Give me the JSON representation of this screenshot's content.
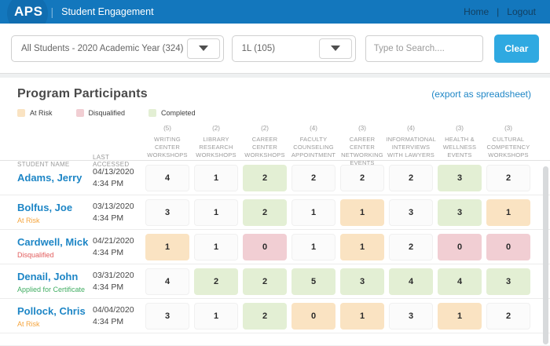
{
  "navbar": {
    "logo": "APS",
    "separator": "|",
    "title": "Student Engagement",
    "home_label": "Home",
    "logout_label": "Logout"
  },
  "filters": {
    "cohort_value": "All Students - 2020 Academic Year  (324)",
    "class_value": "1L (105)",
    "search_placeholder": "Type to Search....",
    "clear_label": "Clear"
  },
  "content": {
    "title": "Program Participants",
    "export_label": "(export as spreadsheet)",
    "legend": [
      {
        "label": "At Risk",
        "color": "#fae3c2"
      },
      {
        "label": "Disqualified",
        "color": "#f1ced3"
      },
      {
        "label": "Completed",
        "color": "#e3efd4"
      }
    ]
  },
  "table": {
    "name_header": "STUDENT NAME",
    "accessed_header": "LAST ACCESSED",
    "columns": [
      {
        "count": "(5)",
        "label": "WRITING CENTER WORKSHOPS"
      },
      {
        "count": "(2)",
        "label": "LIBRARY RESEARCH WORKSHOPS"
      },
      {
        "count": "(2)",
        "label": "CAREER CENTER WORKSHOPS"
      },
      {
        "count": "(4)",
        "label": "FACULTY COUNSELING APPOINTMENT"
      },
      {
        "count": "(3)",
        "label": "CAREER CENTER NETWORKING EVENTS"
      },
      {
        "count": "(4)",
        "label": "INFORMATIONAL INTERVIEWS WITH LAWYERS"
      },
      {
        "count": "(3)",
        "label": "HEALTH & WELLNESS EVENTS"
      },
      {
        "count": "(3)",
        "label": "CULTURAL COMPETENCY WORKSHOPS"
      }
    ],
    "rows": [
      {
        "name": "Adams, Jerry",
        "status": "",
        "status_color": "",
        "date": "04/13/2020",
        "time": "4:34 PM",
        "cells": [
          {
            "value": "4",
            "state": "plain"
          },
          {
            "value": "1",
            "state": "plain"
          },
          {
            "value": "2",
            "state": "green"
          },
          {
            "value": "2",
            "state": "plain"
          },
          {
            "value": "2",
            "state": "plain"
          },
          {
            "value": "2",
            "state": "plain"
          },
          {
            "value": "3",
            "state": "green"
          },
          {
            "value": "2",
            "state": "plain"
          }
        ]
      },
      {
        "name": "Bolfus, Joe",
        "status": "At Risk",
        "status_color": "#f5a43c",
        "date": "03/13/2020",
        "time": "4:34 PM",
        "cells": [
          {
            "value": "3",
            "state": "plain"
          },
          {
            "value": "1",
            "state": "plain"
          },
          {
            "value": "2",
            "state": "green"
          },
          {
            "value": "1",
            "state": "plain"
          },
          {
            "value": "1",
            "state": "orange"
          },
          {
            "value": "3",
            "state": "plain"
          },
          {
            "value": "3",
            "state": "green"
          },
          {
            "value": "1",
            "state": "orange"
          }
        ]
      },
      {
        "name": "Cardwell, Mick",
        "status": "Disqualified",
        "status_color": "#e25d5d",
        "date": "04/21/2020",
        "time": "4:34 PM",
        "cells": [
          {
            "value": "1",
            "state": "orange"
          },
          {
            "value": "1",
            "state": "plain"
          },
          {
            "value": "0",
            "state": "red"
          },
          {
            "value": "1",
            "state": "plain"
          },
          {
            "value": "1",
            "state": "orange"
          },
          {
            "value": "2",
            "state": "plain"
          },
          {
            "value": "0",
            "state": "red"
          },
          {
            "value": "0",
            "state": "red"
          }
        ]
      },
      {
        "name": "Denail, John",
        "status": "Applied for Certificate",
        "status_color": "#41ad63",
        "date": "03/31/2020",
        "time": "4:34 PM",
        "cells": [
          {
            "value": "4",
            "state": "plain"
          },
          {
            "value": "2",
            "state": "green"
          },
          {
            "value": "2",
            "state": "green"
          },
          {
            "value": "5",
            "state": "green"
          },
          {
            "value": "3",
            "state": "green"
          },
          {
            "value": "4",
            "state": "green"
          },
          {
            "value": "4",
            "state": "green"
          },
          {
            "value": "3",
            "state": "green"
          }
        ]
      },
      {
        "name": "Pollock, Chris",
        "status": "At Risk",
        "status_color": "#f5a43c",
        "date": "04/04/2020",
        "time": "4:34 PM",
        "cells": [
          {
            "value": "3",
            "state": "plain"
          },
          {
            "value": "1",
            "state": "plain"
          },
          {
            "value": "2",
            "state": "green"
          },
          {
            "value": "0",
            "state": "orange"
          },
          {
            "value": "1",
            "state": "orange"
          },
          {
            "value": "3",
            "state": "plain"
          },
          {
            "value": "1",
            "state": "orange"
          },
          {
            "value": "2",
            "state": "plain"
          }
        ]
      }
    ]
  },
  "colors": {
    "navbar_blue": "#1377bd",
    "link_blue": "#1e86c6",
    "clear_button_blue": "#2fa9e1",
    "chip_plain": "#fbfbfb",
    "chip_completed_green": "#e3efd4",
    "chip_at_risk_orange": "#fae3c2",
    "chip_disqualified_red": "#f1ced3",
    "status_at_risk": "#f5a43c",
    "status_disqualified": "#e25d5d",
    "status_applied_for_certificate": "#41ad63"
  }
}
